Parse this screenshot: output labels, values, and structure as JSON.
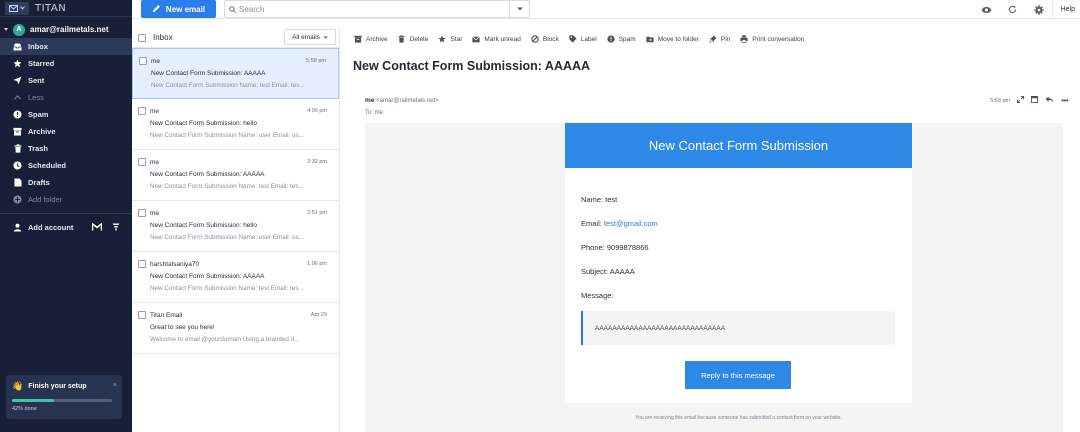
{
  "app": {
    "brand": "TITAN",
    "new_email_label": "New email",
    "search_placeholder": "Search",
    "help_label": "Help"
  },
  "sidebar": {
    "account_initial": "A",
    "account_email": "amar@railmetals.net",
    "items": [
      {
        "label": "Inbox",
        "icon": "inbox-icon",
        "active": true
      },
      {
        "label": "Starred",
        "icon": "star-icon"
      },
      {
        "label": "Sent",
        "icon": "send-icon"
      },
      {
        "label": "Less",
        "icon": "chevron-up-icon"
      },
      {
        "label": "Spam",
        "icon": "spam-icon"
      },
      {
        "label": "Archive",
        "icon": "archive-icon"
      },
      {
        "label": "Trash",
        "icon": "trash-icon"
      },
      {
        "label": "Scheduled",
        "icon": "clock-icon"
      },
      {
        "label": "Drafts",
        "icon": "draft-icon"
      },
      {
        "label": "Add folder",
        "icon": "plus-icon"
      }
    ],
    "add_account_label": "Add account",
    "setup_title": "Finish your setup",
    "setup_progress_text": "42% done",
    "setup_progress": 0.42
  },
  "list": {
    "title": "Inbox",
    "filter_label": "All emails",
    "emails": [
      {
        "from": "me",
        "time": "5:58 pm",
        "subject": "New Contact Form Submission: AAAAA",
        "preview": "New Contact Form Submission Name: test Email: tes..."
      },
      {
        "from": "me",
        "time": "4:06 pm",
        "subject": "New Contact Form Submission: hello",
        "preview": "New Contact Form Submission Name: user Email: us..."
      },
      {
        "from": "me",
        "time": "3:32 pm",
        "subject": "New Contact Form Submission: AAAAA",
        "preview": "New Contact Form Submission Name: test Email: tes..."
      },
      {
        "from": "me",
        "time": "2:51 pm",
        "subject": "New Contact Form Submission: hello",
        "preview": "New Contact Form Submission Name: user Email: us..."
      },
      {
        "from": "harshtalsaniya70",
        "time": "1:06 pm",
        "subject": "New Contact Form Submission: AAAAA",
        "preview": "New Contact Form Submission Name: test Email: tes..."
      },
      {
        "from": "Titan Email",
        "time": "Apr 29",
        "subject": "Great to see you here!",
        "preview": "Welcome to email @yourdomain Using a branded d..."
      }
    ]
  },
  "toolbar": {
    "archive": "Archive",
    "delete": "Delete",
    "star": "Star",
    "mark_unread": "Mark unread",
    "block": "Block",
    "label": "Label",
    "spam": "Spam",
    "move": "Move to folder",
    "pin": "Pin",
    "print": "Print conversation"
  },
  "message": {
    "title": "New Contact Form Submission: AAAAA",
    "sender_name": "me",
    "sender_addr": "<amar@railmetals.net>",
    "to": "To: me",
    "time": "5:58 pm",
    "email": {
      "header": "New Contact Form Submission",
      "name_line": "Name: test",
      "email_prefix": "Email: ",
      "email_link": "test@gmail.com",
      "phone_line": "Phone: 9099878866",
      "subject_line": "Subject: AAAAA",
      "message_label": "Message:",
      "message_body": "AAAAAAAAAAAAAAAAAAAAAAAAAAAAAA",
      "reply_button": "Reply to this message",
      "footer": "You are receiving this email because someone has submitted a contact form on your website."
    }
  },
  "colors": {
    "sidebar_bg": "#172036",
    "accent": "#2d88e6",
    "selected_row": "#e6efff",
    "progress": "#3cc7a8"
  }
}
